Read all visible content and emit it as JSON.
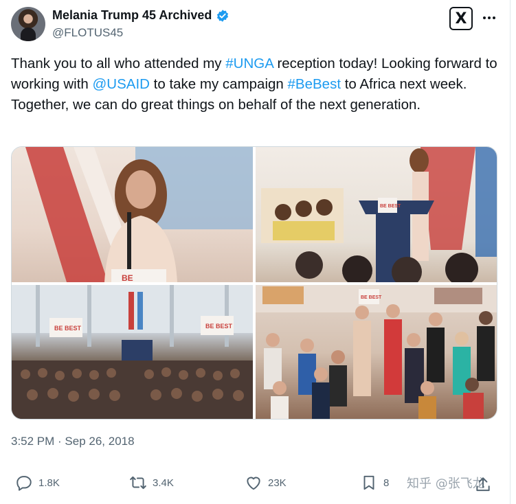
{
  "author": {
    "display_name": "Melania Trump 45 Archived",
    "handle": "@FLOTUS45",
    "verified": true
  },
  "tweet": {
    "segments": [
      {
        "text": "Thank you to all who attended my ",
        "type": "text"
      },
      {
        "text": "#UNGA",
        "type": "link"
      },
      {
        "text": " reception today! Looking forward to working with ",
        "type": "text"
      },
      {
        "text": "@USAID",
        "type": "link"
      },
      {
        "text": " to take my campaign ",
        "type": "text"
      },
      {
        "text": "#BeBest",
        "type": "link"
      },
      {
        "text": " to Africa next week. Together, we can do great things on behalf of the next generation.",
        "type": "text"
      }
    ]
  },
  "media": {
    "photo1_sign": "BE",
    "photo2_sign": "BE BEST",
    "photo3_sign_left": "BE BEST",
    "photo3_sign_right": "BE BEST",
    "photo4_sign": "BE BEST"
  },
  "timestamp": "3:52 PM · Sep 26, 2018",
  "actions": {
    "replies": "1.8K",
    "retweets": "3.4K",
    "likes": "23K",
    "bookmarks": "8"
  },
  "watermark": "知乎 @张飞龙",
  "colors": {
    "accent": "#1d9bf0",
    "text": "#0f1419",
    "muted": "#536471"
  }
}
